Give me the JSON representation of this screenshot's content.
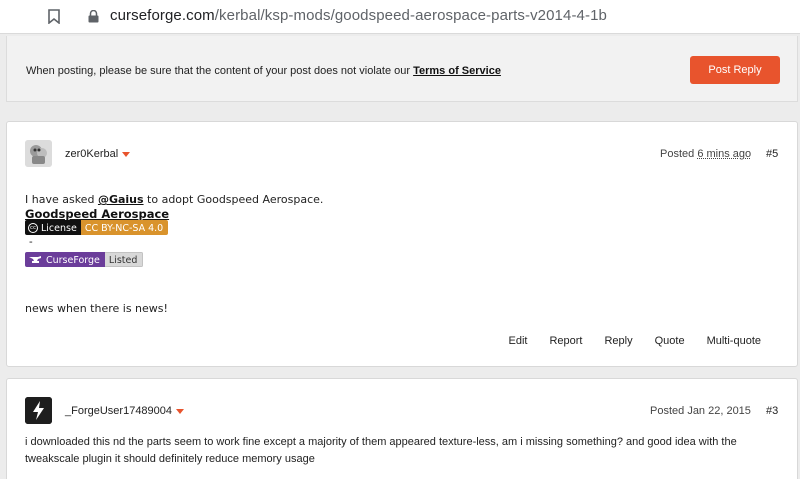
{
  "browser": {
    "url_domain": "curseforge.com",
    "url_path": "/kerbal/ksp-mods/goodspeed-aerospace-parts-v2014-4-1b"
  },
  "notice": {
    "text": "When posting, please be sure that the content of your post does not violate our",
    "tos_link": "Terms of Service",
    "post_reply_label": "Post Reply"
  },
  "posts": [
    {
      "author": "zer0Kerbal",
      "posted_prefix": "Posted",
      "posted_time": "6 mins ago",
      "number": "#5",
      "text_before": "I have asked",
      "mention": "@Gaius",
      "text_after": "to adopt Goodspeed Aerospace.",
      "mod_name": "Goodspeed Aerospace",
      "license_badge": {
        "left": "License",
        "right": "CC BY-NC-SA 4.0"
      },
      "dash": "-",
      "curseforge_badge": {
        "left": "CurseForge",
        "right": "Listed"
      },
      "footer_text": "news when there is news!",
      "actions": [
        "Edit",
        "Report",
        "Reply",
        "Quote",
        "Multi-quote"
      ]
    },
    {
      "author": "_ForgeUser17489004",
      "posted_prefix": "Posted",
      "posted_time": "Jan 22, 2015",
      "number": "#3",
      "text_line1": "i downloaded this nd the parts seem to work fine except a majority of them appeared texture-less, am i missing something? and good idea with the",
      "text_line2": "tweakscale plugin it should definitely reduce memory usage"
    }
  ],
  "colors": {
    "accent": "#e8542d",
    "license_orange": "#d9932c",
    "curseforge_purple": "#6b3d9a"
  },
  "icons": [
    "bookmark-icon",
    "lock-icon",
    "caret-down-icon",
    "creative-commons-icon",
    "curseforge-logo-icon",
    "lightning-avatar-icon"
  ]
}
